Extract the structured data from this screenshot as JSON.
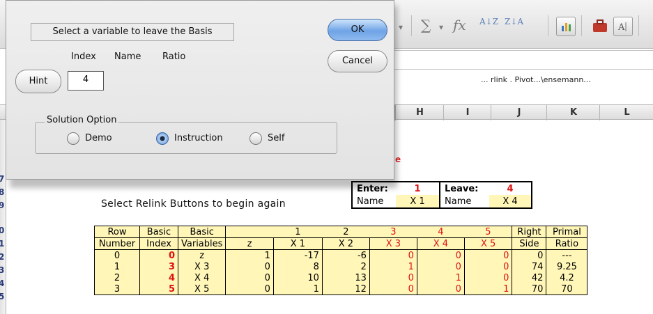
{
  "dialog": {
    "prompt": "Select a variable to leave the Basis",
    "ok_label": "OK",
    "cancel_label": "Cancel",
    "hint_label": "Hint",
    "col_index": "Index",
    "col_name": "Name",
    "col_ratio": "Ratio",
    "index_value": "4",
    "options_title": "Solution Option",
    "options": [
      {
        "label": "Demo",
        "selected": false
      },
      {
        "label": "Instruction",
        "selected": true
      },
      {
        "label": "Self",
        "selected": false
      }
    ]
  },
  "toolbar": {
    "sigma": "∑",
    "fx": "fx",
    "sort_asc": "A↓Z",
    "sort_desc": "Z↓A"
  },
  "sheet": {
    "cell_ref_text": "... rlink . Pivot...\\ensemann...",
    "columns": [
      "H",
      "I",
      "J",
      "K",
      "L"
    ],
    "row_numbers": [
      "7",
      "8",
      "9",
      "0",
      "1",
      "2",
      "3",
      "4",
      "5"
    ],
    "red_mark": "e",
    "relink_text": "Select Relink Buttons to begin again",
    "enter_leave": {
      "enter_label": "Enter:",
      "enter_value": "1",
      "leave_label": "Leave:",
      "leave_value": "4",
      "name_label_1": "Name",
      "enter_name": "X 1",
      "name_label_2": "Name",
      "leave_name": "X 4"
    },
    "table": {
      "head1": [
        "Row",
        "Basic",
        "Basic",
        "",
        "1",
        "2",
        "3",
        "4",
        "5",
        "Right",
        "Primal"
      ],
      "head2": [
        "Number",
        "Index",
        "Variables",
        "z",
        "X 1",
        "X 2",
        "X 3",
        "X 4",
        "X 5",
        "Side",
        "Ratio"
      ],
      "rows": [
        [
          "0",
          "0",
          "z",
          "1",
          "-17",
          "-6",
          "0",
          "0",
          "0",
          "0",
          "---"
        ],
        [
          "1",
          "3",
          "X 3",
          "0",
          "8",
          "2",
          "1",
          "0",
          "0",
          "74",
          "9.25"
        ],
        [
          "2",
          "4",
          "X 4",
          "0",
          "10",
          "13",
          "0",
          "1",
          "0",
          "42",
          "4.2"
        ],
        [
          "3",
          "5",
          "X 5",
          "0",
          "1",
          "12",
          "0",
          "0",
          "1",
          "70",
          "70"
        ]
      ]
    }
  }
}
